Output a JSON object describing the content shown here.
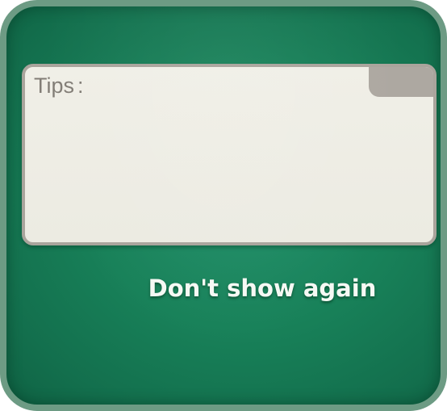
{
  "dialog": {
    "tips": {
      "label": "Tips",
      "colon": ":",
      "body": ""
    },
    "dont_show_again_label": "Don't show again"
  },
  "colors": {
    "background_green": "#188159",
    "frame_border": "#6d9b84",
    "card_fill": "#eeede5",
    "card_border": "#a9a49c",
    "tab_fill": "#ada8a1",
    "label_text": "#827d76",
    "button_text": "#f6f9f4"
  }
}
